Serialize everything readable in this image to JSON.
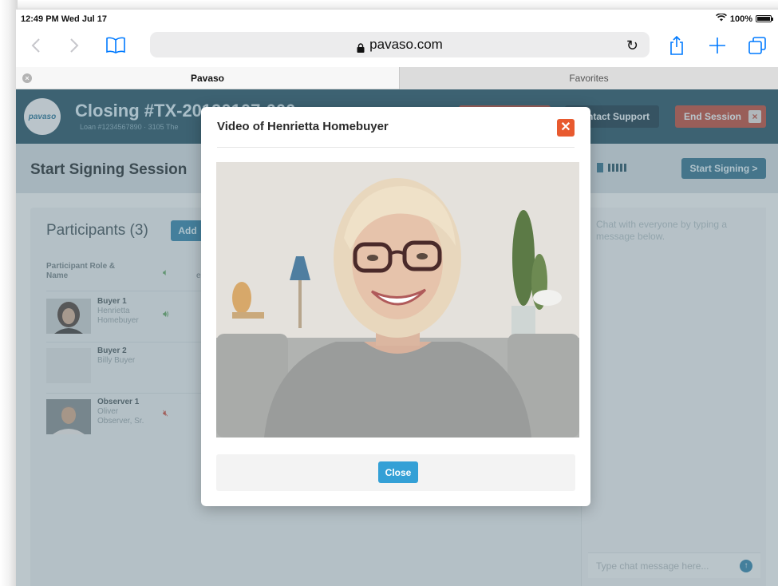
{
  "statusbar": {
    "time": "12:49 PM  Wed Jul 17",
    "battery": "100%"
  },
  "browser": {
    "url": "pavaso.com",
    "tabs": [
      {
        "label": "Pavaso",
        "active": true
      },
      {
        "label": "Favorites",
        "active": false
      }
    ]
  },
  "app": {
    "logo_text": "pavaso",
    "closing_title": "Closing #TX-2019",
    "closing_title_tail": "0107-000",
    "closing_sub": "Loan #1234567890  ·  3105 The",
    "header_buttons": {
      "support": "Contact Support",
      "end_session": "End Session"
    },
    "session_title": "Start Signing Session",
    "start_signing": "Start Signing >",
    "participants_title": "Participants (3)",
    "add_label": "Add",
    "column_header": "Participant Role & Name",
    "column_e": "e",
    "participants": [
      {
        "role": "Buyer 1",
        "name": "Henrietta Homebuyer",
        "audio": "on"
      },
      {
        "role": "Buyer 2",
        "name": "Billy Buyer",
        "audio": "none"
      },
      {
        "role": "Observer 1",
        "name": "Oliver Observer, Sr.",
        "audio": "muted"
      }
    ],
    "chat_hint": "Chat with everyone by typing a message below.",
    "chat_placeholder": "Type chat message here..."
  },
  "modal": {
    "title": "Video of Henrietta Homebuyer",
    "close_label": "Close"
  },
  "colors": {
    "accent": "#34a0d6",
    "danger": "#e85a2f",
    "header": "#1f4f63"
  }
}
